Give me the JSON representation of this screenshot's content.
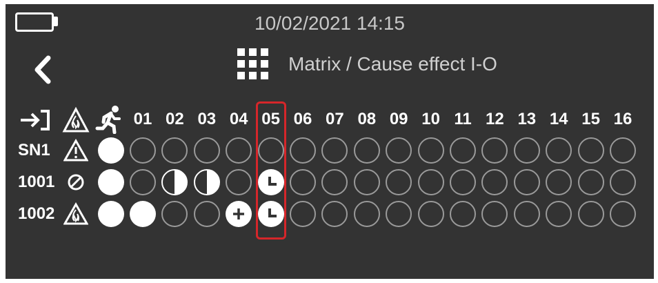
{
  "status": {
    "datetime": "10/02/2021   14:15"
  },
  "header": {
    "title": "Matrix / Cause effect I-O",
    "grid_icon": "grid-icon",
    "back_icon": "chevron-left-icon"
  },
  "matrix": {
    "columns": [
      "01",
      "02",
      "03",
      "04",
      "05",
      "06",
      "07",
      "08",
      "09",
      "10",
      "11",
      "12",
      "13",
      "14",
      "15",
      "16"
    ],
    "highlighted_column": "05",
    "highlight_color": "#d6262a",
    "rows": [
      {
        "label": "SN1",
        "icon": "warning-triangle-icon",
        "cells": [
          "empty",
          "empty",
          "empty",
          "empty",
          "empty",
          "empty",
          "empty",
          "empty",
          "empty",
          "empty",
          "empty",
          "empty",
          "empty",
          "empty",
          "empty",
          "empty"
        ]
      },
      {
        "label": "1001",
        "icon": "disabled-circle-icon",
        "cells": [
          "empty",
          "half",
          "half",
          "empty",
          "timer",
          "empty",
          "empty",
          "empty",
          "empty",
          "empty",
          "empty",
          "empty",
          "empty",
          "empty",
          "empty",
          "empty"
        ]
      },
      {
        "label": "1002",
        "icon": "fire-triangle-icon",
        "cells": [
          "full",
          "empty",
          "empty",
          "plus",
          "timer",
          "empty",
          "empty",
          "empty",
          "empty",
          "empty",
          "empty",
          "empty",
          "empty",
          "empty",
          "empty",
          "empty"
        ]
      }
    ]
  }
}
